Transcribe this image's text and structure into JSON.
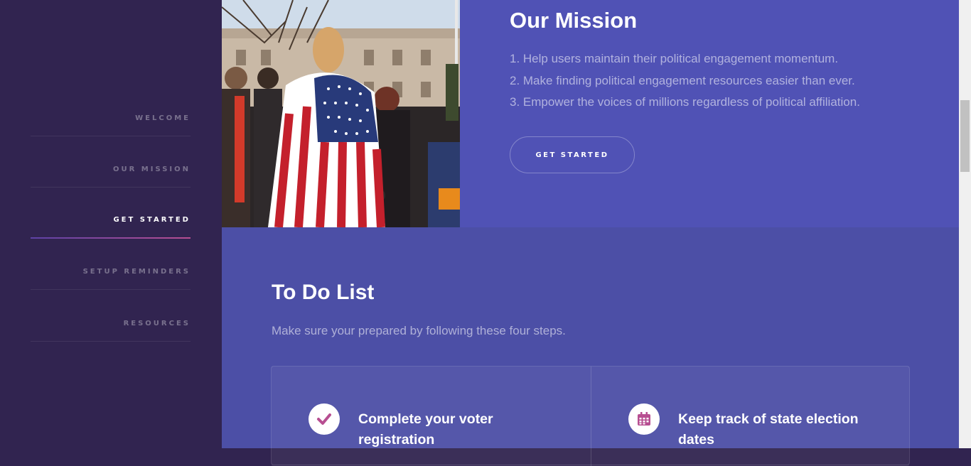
{
  "sidebar": {
    "items": [
      {
        "label": "WELCOME",
        "active": false
      },
      {
        "label": "OUR MISSION",
        "active": false
      },
      {
        "label": "GET STARTED",
        "active": true
      },
      {
        "label": "SETUP REMINDERS",
        "active": false
      },
      {
        "label": "RESOURCES",
        "active": false
      }
    ]
  },
  "mission": {
    "title": "Our Mission",
    "list": [
      "1. Help users maintain their political engagement momentum.",
      "2. Make finding political engagement resources easier than ever.",
      "3. Empower the voices of millions regardless of political affiliation."
    ],
    "button_label": "GET STARTED",
    "image_icon": "protest-crowd-flag-photo"
  },
  "todo": {
    "title": "To Do List",
    "subtitle": "Make sure your prepared by following these four steps.",
    "cards": [
      {
        "title": "Complete your voter registration",
        "icon": "check-icon"
      },
      {
        "title": "Keep track of state election dates",
        "icon": "calendar-icon"
      }
    ]
  },
  "colors": {
    "sidebar_bg": "#312450",
    "mission_bg": "#5052b5",
    "todo_bg": "#4c4fa6",
    "accent_gradient_start": "#5e42a6",
    "accent_gradient_end": "#b74e91",
    "icon_color": "#b74e91"
  }
}
